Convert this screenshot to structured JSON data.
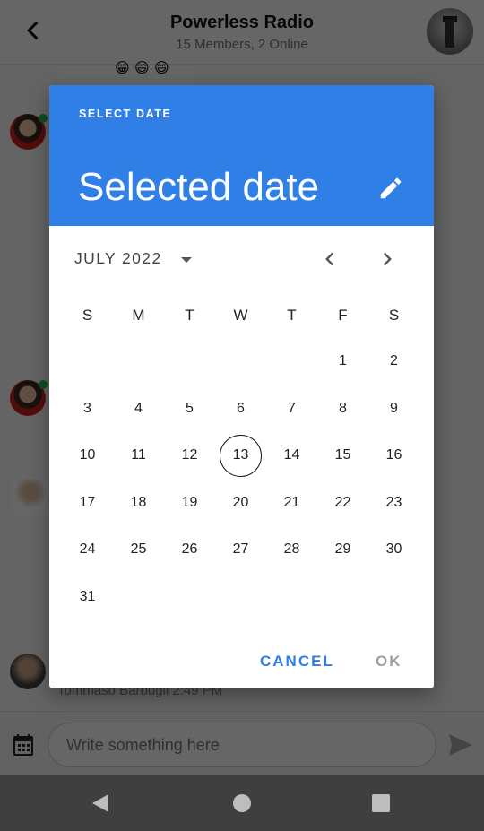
{
  "header": {
    "title": "Powerless Radio",
    "subtitle": "15 Members, 2 Online"
  },
  "chat": {
    "visible_emojis": [
      "😁",
      "😄",
      "😄"
    ],
    "last_message_meta": "Tommaso Barbugli   2:49 PM"
  },
  "composer": {
    "placeholder": "Write something here"
  },
  "date_picker": {
    "kicker": "SELECT DATE",
    "selected_text": "Selected date",
    "month_label": "JULY 2022",
    "weekday_headers": [
      "S",
      "M",
      "T",
      "W",
      "T",
      "F",
      "S"
    ],
    "weeks": [
      [
        "",
        "",
        "",
        "",
        "",
        "1",
        "2"
      ],
      [
        "3",
        "4",
        "5",
        "6",
        "7",
        "8",
        "9"
      ],
      [
        "10",
        "11",
        "12",
        "13",
        "14",
        "15",
        "16"
      ],
      [
        "17",
        "18",
        "19",
        "20",
        "21",
        "22",
        "23"
      ],
      [
        "24",
        "25",
        "26",
        "27",
        "28",
        "29",
        "30"
      ],
      [
        "31",
        "",
        "",
        "",
        "",
        "",
        ""
      ]
    ],
    "today": "13",
    "cancel_label": "CANCEL",
    "ok_label": "OK",
    "accent_color": "#2f7fe7"
  }
}
